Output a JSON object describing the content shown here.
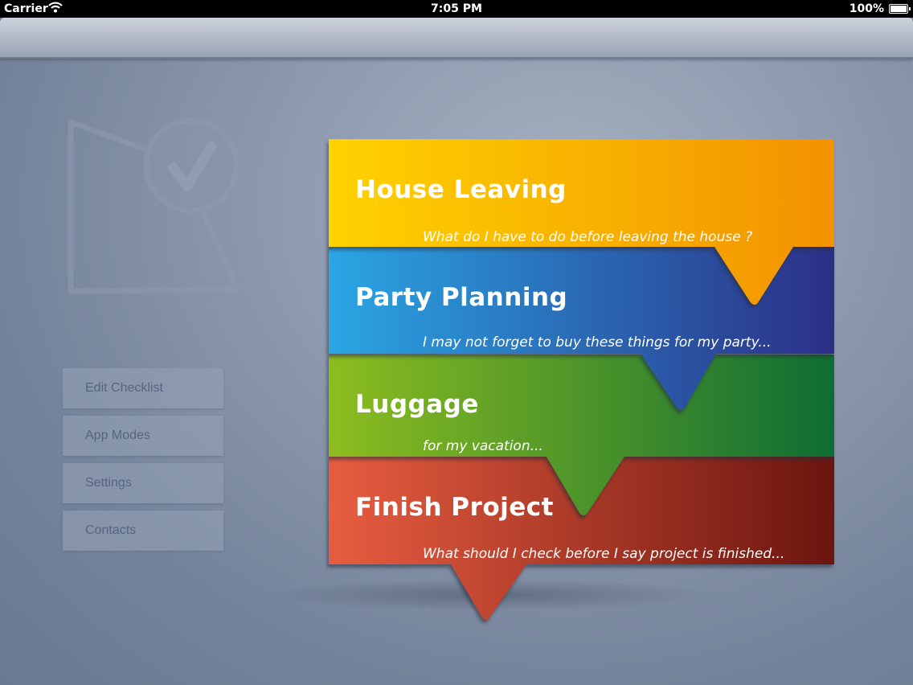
{
  "status_bar": {
    "carrier": "Carrier",
    "time": "7:05 PM",
    "battery": "100%"
  },
  "menu": [
    {
      "label": "Edit Checklist"
    },
    {
      "label": "App Modes"
    },
    {
      "label": "Settings"
    },
    {
      "label": "Contacts"
    }
  ],
  "checklists": [
    {
      "title": "House Leaving",
      "subtitle": "What do I have to do before leaving the house ?",
      "colors": [
        "#ffd200",
        "#f29200"
      ]
    },
    {
      "title": "Party Planning",
      "subtitle": "I may not forget to buy these things for my party...",
      "colors": [
        "#2aa6e4",
        "#2b2f86"
      ]
    },
    {
      "title": "Luggage",
      "subtitle": "for my vacation...",
      "colors": [
        "#8dbd1f",
        "#0e6d34"
      ]
    },
    {
      "title": "Finish Project",
      "subtitle": "What should I check before I say project is finished...",
      "colors": [
        "#e85d40",
        "#6b150f"
      ]
    }
  ],
  "icons": {
    "wifi": "wifi-icon",
    "battery": "battery-icon",
    "logo": "checklist-logo-icon"
  }
}
